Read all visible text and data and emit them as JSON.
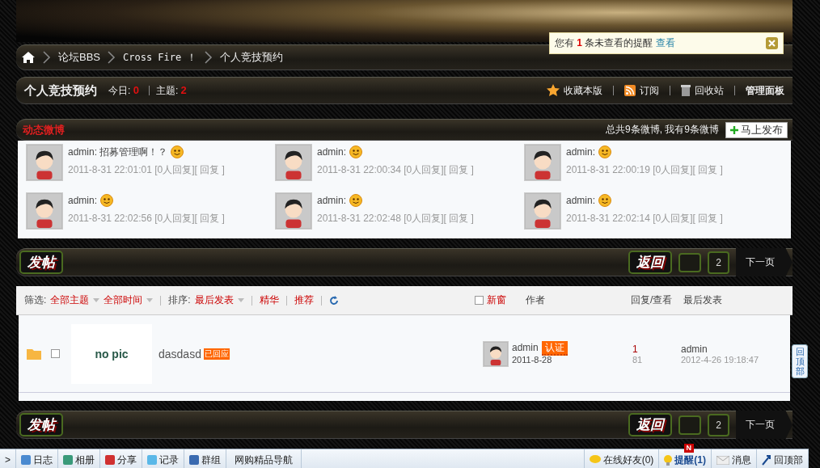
{
  "breadcrumb": {
    "items": [
      "论坛BBS",
      "Cross Fire ！",
      "个人竞技预约"
    ]
  },
  "notice": {
    "prefix": "您有",
    "count": "1",
    "suffix": "条未查看的提醒",
    "link": "查看"
  },
  "forum": {
    "title": "个人竞技预约",
    "today_label": "今日:",
    "today": "0",
    "threads_label": "主题:",
    "threads": "2",
    "actions": [
      "收藏本版",
      "订阅",
      "回收站"
    ],
    "admin": "管理面板"
  },
  "weibo": {
    "title": "动态微博",
    "summary": "总共9条微博, 我有9条微博",
    "post_button": "马上发布",
    "entries": [
      {
        "author": "admin:",
        "text": "招募管理啊！？",
        "time": "2011-8-31 22:01:01",
        "replies": "[0人回复]",
        "reply": "[ 回复 ]"
      },
      {
        "author": "admin:",
        "time": "2011-8-31 22:00:34",
        "replies": "[0人回复]",
        "reply": "[ 回复 ]"
      },
      {
        "author": "admin:",
        "time": "2011-8-31 22:00:19",
        "replies": "[0人回复]",
        "reply": "[ 回复 ]"
      },
      {
        "author": "admin:",
        "time": "2011-8-31 22:02:56",
        "replies": "[0人回复]",
        "reply": "[ 回复 ]"
      },
      {
        "author": "admin:",
        "time": "2011-8-31 22:02:48",
        "replies": "[0人回复]",
        "reply": "[ 回复 ]"
      },
      {
        "author": "admin:",
        "time": "2011-8-31 22:02:14",
        "replies": "[0人回复]",
        "reply": "[ 回复 ]"
      }
    ]
  },
  "post_bars": [
    {
      "new_button": "发帖",
      "back_button": "返回",
      "page": "2",
      "next": "下一页"
    },
    {
      "new_button": "发帖",
      "back_button": "返回",
      "page": "2",
      "next": "下一页"
    }
  ],
  "filter": {
    "filter_label": "筛选:",
    "topic": "全部主题",
    "time": "全部时间",
    "sort_label": "排序:",
    "sort": "最后发表",
    "digest": "精华",
    "recommend": "推荐",
    "new_window": {
      "label": "新窗",
      "checked": false
    },
    "columns": [
      "作者",
      "回复/查看",
      "最后发表"
    ]
  },
  "threads": [
    {
      "thumb": "no pic",
      "title": "dasdasd",
      "tag": "已回应",
      "checked": false,
      "author": "admin",
      "badge": "认证",
      "date": "2011-8-28",
      "replies": "1",
      "views": "81",
      "last_author": "admin",
      "last_time": "2012-4-26 19:18:47"
    }
  ],
  "back_to_top": "回顶部",
  "toolbar": {
    "expand": ">",
    "items": [
      "日志",
      "相册",
      "分享",
      "记录",
      "群组"
    ],
    "link": "网购精品导航",
    "online": "在线好友(0)",
    "remind": "提醒(1)",
    "remind_badge": "N",
    "messages": "消息",
    "top": "回顶部"
  }
}
